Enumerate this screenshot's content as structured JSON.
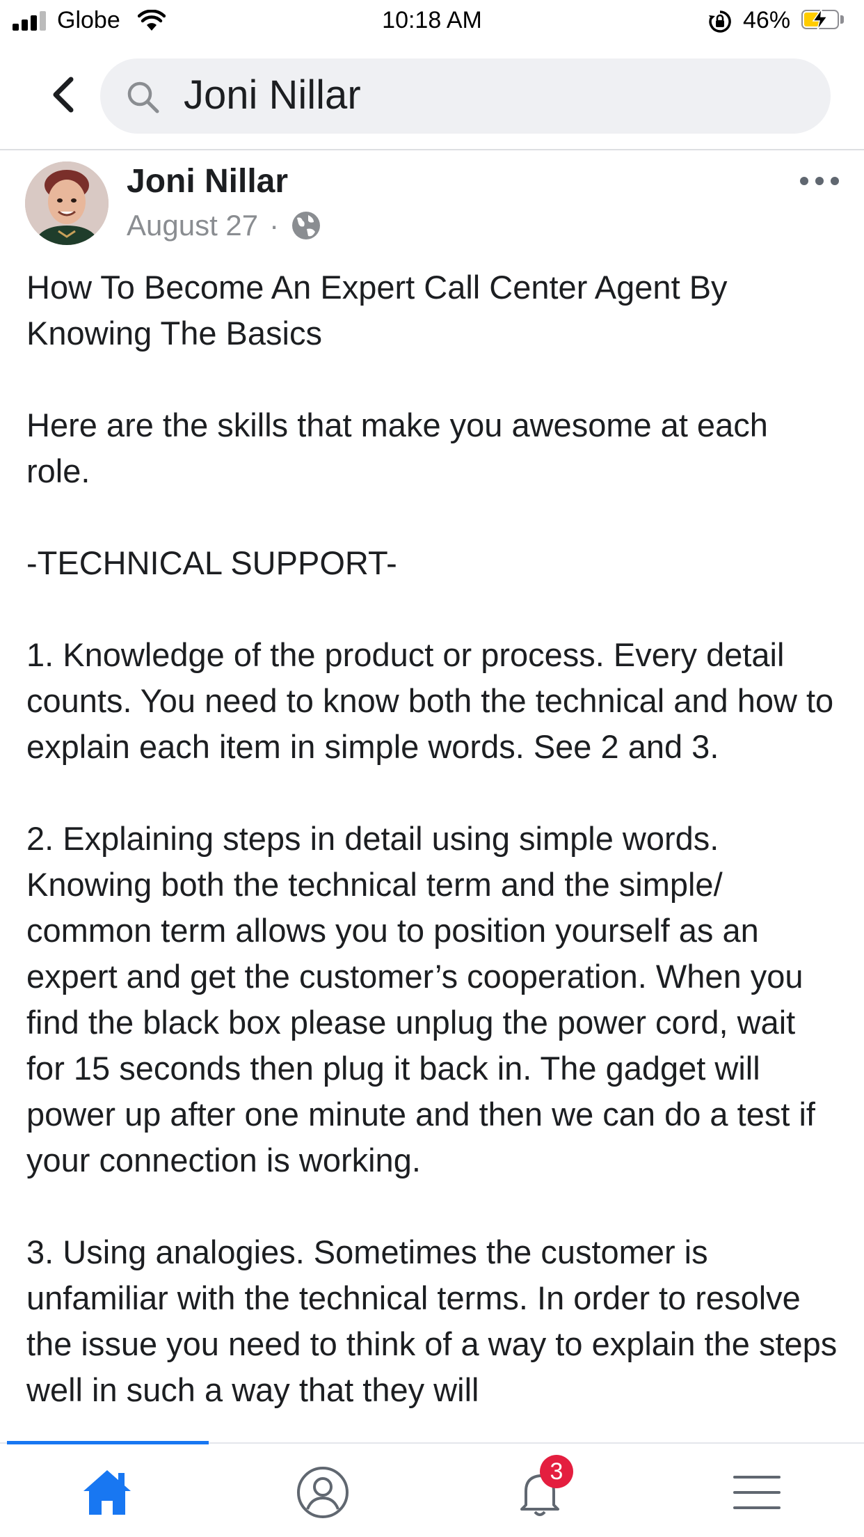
{
  "status_bar": {
    "carrier": "Globe",
    "time": "10:18 AM",
    "battery": "46%",
    "battery_level": 0.46,
    "icons": [
      "signal-icon",
      "wifi-icon",
      "rotation-lock-icon",
      "battery-icon",
      "charging-bolt-icon"
    ]
  },
  "header": {
    "search_value": "Joni Nillar",
    "icons": [
      "back-arrow-icon",
      "search-icon"
    ]
  },
  "post": {
    "author": "Joni Nillar",
    "date": "August 27",
    "separator": "·",
    "privacy_icon": "globe-icon",
    "more_icon": "more-dots-icon",
    "paragraphs": [
      "How To Become An Expert Call Center Agent By Knowing The Basics",
      "Here are the skills that make you awesome at each role.",
      "-TECHNICAL SUPPORT-",
      "1. Knowledge of the product or process. Every detail counts. You need to know both the technical and how to explain each item in simple words. See 2 and 3.",
      "2. Explaining steps in detail using simple words. Knowing both the technical term and the simple/ common term allows you to position yourself as an expert and get the customer’s cooperation. When you find the black box please unplug the power cord, wait for 15 seconds then plug it back in. The gadget will power up after one minute and then we can do a test if your connection is working.",
      "3. Using analogies. Sometimes the customer is unfamiliar with the technical terms. In order to resolve the issue you need to think of a way to explain the steps well in such a way that they will"
    ]
  },
  "bottom_nav": {
    "items": [
      {
        "icon": "home-icon",
        "active": true
      },
      {
        "icon": "profile-icon",
        "active": false
      },
      {
        "icon": "notifications-bell-icon",
        "active": false,
        "badge": "3"
      },
      {
        "icon": "menu-icon",
        "active": false
      }
    ],
    "colors": {
      "active": "#1877f2",
      "inactive": "#606770",
      "badge": "#e41e3f"
    }
  }
}
